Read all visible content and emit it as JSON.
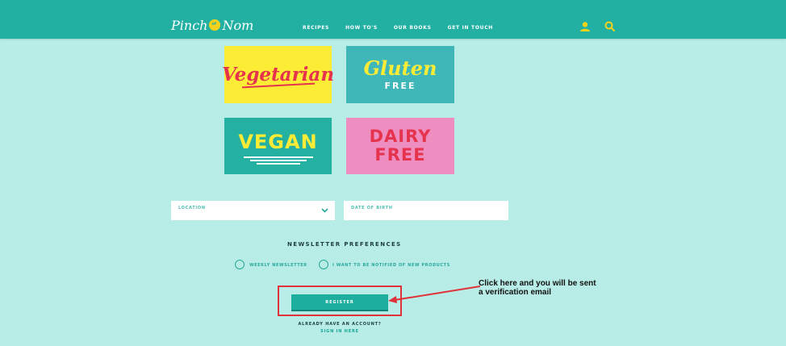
{
  "header": {
    "logo_left": "Pinch",
    "logo_mark": "of",
    "logo_right": "Nom",
    "nav": [
      "RECIPES",
      "HOW TO'S",
      "OUR BOOKS",
      "GET IN TOUCH"
    ],
    "icons": [
      "user-icon",
      "search-icon"
    ]
  },
  "diet_tiles": {
    "vegetarian": "Vegetarian",
    "gluten_free_script": "Gluten",
    "gluten_free_sub": "FREE",
    "vegan": "VEGAN",
    "dairy_free_line1": "DAIRY",
    "dairy_free_line2": "FREE"
  },
  "form": {
    "location_label": "LOCATION",
    "dob_label": "DATE OF BIRTH",
    "newsletter_title": "NEWSLETTER PREFERENCES",
    "options": [
      "WEEKLY NEWSLETTER",
      "I WANT TO BE NOTIFIED OF NEW PRODUCTS"
    ],
    "register_label": "REGISTER",
    "account_prompt": "ALREADY HAVE AN ACCOUNT?",
    "signin_label": "SIGN IN HERE"
  },
  "annotation": {
    "line1": "Click here and you will be sent",
    "line2": "a verification email"
  },
  "colors": {
    "header_bg": "#21b0a2",
    "page_bg": "#b7ede6",
    "accent_yellow": "#f7d21d",
    "annotation_red": "#e1323a"
  }
}
